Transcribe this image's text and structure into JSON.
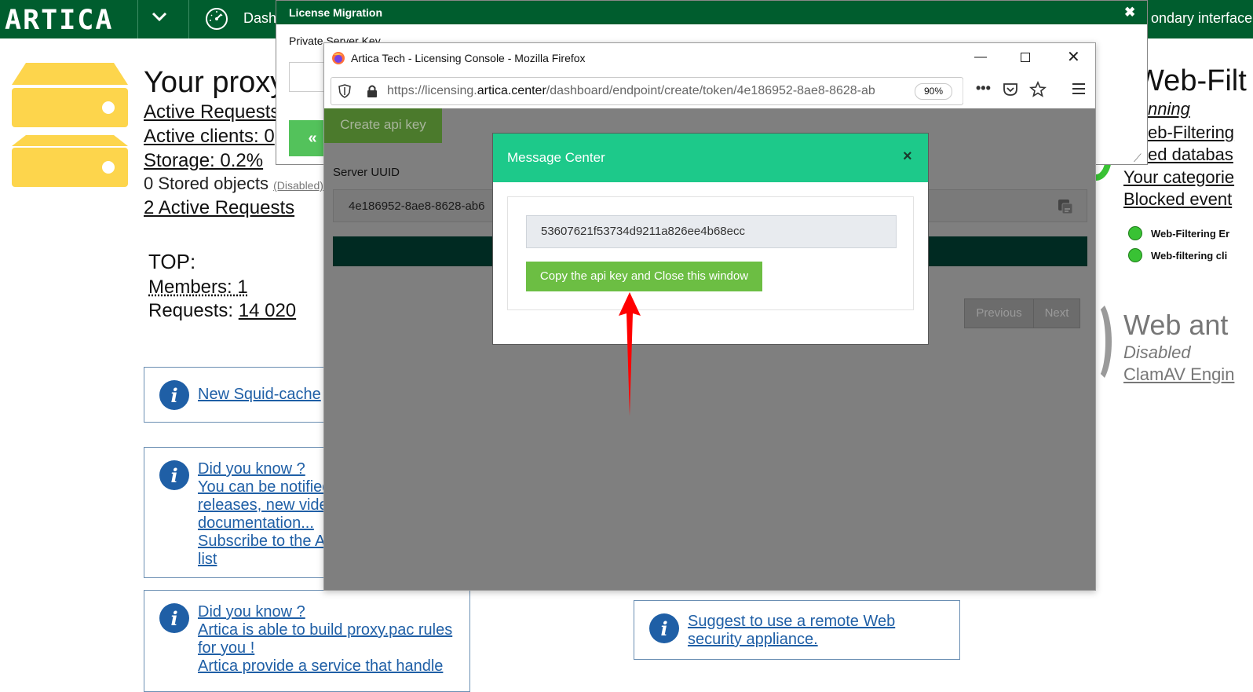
{
  "app": {
    "logo": "ARTICA",
    "nav_dashboard": "Dash",
    "nav_secondary": "ondary interface"
  },
  "proxy": {
    "title": "Your proxy",
    "active_requests_link": "Active Requests",
    "active_clients": "Active clients: 0",
    "storage": "Storage: 0.2%",
    "stored_objects": "0 Stored objects",
    "stored_disabled": "(Disabled)",
    "active_requests_2": "2 Active Requests",
    "top_label": "TOP:",
    "members": "Members: 1",
    "requests_label": "Requests: ",
    "requests_value": "14 020"
  },
  "cards": {
    "squid": [
      "New Squid-cache"
    ],
    "notify": [
      "Did you know ?",
      "You can be notified",
      "releases, new vide",
      "documentation...",
      "Subscribe to the A",
      "list"
    ],
    "pac": [
      "Did you know ?",
      "Artica is able to build proxy.pac rules",
      "for you !",
      "Artica provide a service that handle"
    ],
    "suggest": [
      "Suggest to use a remote Web",
      "security appliance."
    ]
  },
  "webfiltering": {
    "title": "Web-Filt",
    "running": "nning",
    "link1": "eb-Filtering",
    "link2": "ed databas",
    "categories": "Your categorie",
    "blocked": "Blocked event",
    "svc1": "Web-Filtering Er",
    "svc2": "Web-filtering cli",
    "status_color": "#39c234"
  },
  "webav": {
    "title": "Web ant",
    "disabled": "Disabled",
    "clamav": "ClamAV Engin"
  },
  "license_dialog": {
    "title": "License Migration",
    "close": "✖",
    "private_key_label": "Private Server Key",
    "back_button": "«"
  },
  "firefox": {
    "window_title": "Artica Tech - Licensing Console - Mozilla Firefox",
    "url_prefix": "https://licensing.",
    "url_domain": "artica.center",
    "url_path": "/dashboard/endpoint/create/token/4e186952-8ae8-8628-ab",
    "zoom": "90%",
    "min": "—",
    "close": "✕",
    "dots": "•••"
  },
  "console": {
    "create_api_key": "Create api key",
    "server_uuid_label": "Server UUID",
    "server_uuid_value": "4e186952-8ae8-8628-ab6",
    "previous": "Previous",
    "next": "Next"
  },
  "message_center": {
    "title": "Message Center",
    "close": "×",
    "api_key": "53607621f53734d9211a826ee4b68ecc",
    "copy_button": "Copy the api key and Close this window"
  },
  "colors": {
    "topbar": "#005d2e",
    "message_header": "#1dc98a",
    "copy_button": "#6cbe43",
    "arrow": "#ff0000",
    "server_icon": "#fdd54c"
  }
}
